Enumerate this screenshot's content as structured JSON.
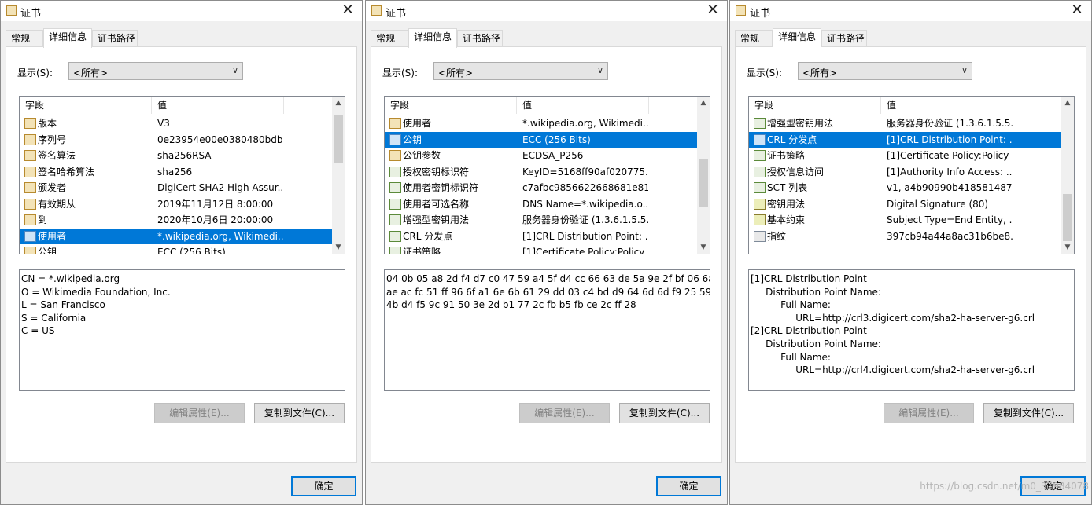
{
  "watermark": "https://blog.csdn.net/m0_37984078",
  "dialogs": [
    {
      "title": "证书",
      "close": "✕",
      "tabs": [
        "常规",
        "详细信息",
        "证书路径"
      ],
      "active_tab": 1,
      "show_label": "显示(S):",
      "show_value": "<所有>",
      "columns": [
        "字段",
        "值"
      ],
      "rows": [
        {
          "icon": "cert-field-icon",
          "field": "版本",
          "value": "V3",
          "selected": false
        },
        {
          "icon": "cert-field-icon",
          "field": "序列号",
          "value": "0e23954e00e0380480bdb...",
          "selected": false
        },
        {
          "icon": "cert-field-icon",
          "field": "签名算法",
          "value": "sha256RSA",
          "selected": false
        },
        {
          "icon": "cert-field-icon",
          "field": "签名哈希算法",
          "value": "sha256",
          "selected": false
        },
        {
          "icon": "cert-field-icon",
          "field": "颁发者",
          "value": "DigiCert SHA2 High Assur...",
          "selected": false
        },
        {
          "icon": "cert-field-icon",
          "field": "有效期从",
          "value": "2019年11月12日 8:00:00",
          "selected": false
        },
        {
          "icon": "cert-field-icon",
          "field": "到",
          "value": "2020年10月6日 20:00:00",
          "selected": false
        },
        {
          "icon": "cert-field-icon",
          "field": "使用者",
          "value": "*.wikipedia.org, Wikimedi...",
          "selected": true
        },
        {
          "icon": "cert-field-icon",
          "field": "公钥",
          "value": "ECC (256 Bits)",
          "selected": false
        }
      ],
      "scroll_thumb_fraction_top": 0.05,
      "scroll_thumb_fraction_size": 0.36,
      "details": [
        "CN = *.wikipedia.org",
        "O = Wikimedia Foundation, Inc.",
        "L = San Francisco",
        "S = California",
        "C = US"
      ],
      "edit_button": "编辑属性(E)...",
      "copy_button": "复制到文件(C)...",
      "ok_button": "确定"
    },
    {
      "title": "证书",
      "close": "✕",
      "tabs": [
        "常规",
        "详细信息",
        "证书路径"
      ],
      "active_tab": 1,
      "show_label": "显示(S):",
      "show_value": "<所有>",
      "columns": [
        "字段",
        "值"
      ],
      "rows": [
        {
          "icon": "cert-field-icon",
          "field": "使用者",
          "value": "*.wikipedia.org, Wikimedi...",
          "selected": false
        },
        {
          "icon": "cert-field-icon",
          "field": "公钥",
          "value": "ECC (256 Bits)",
          "selected": true
        },
        {
          "icon": "cert-field-icon",
          "field": "公钥参数",
          "value": "ECDSA_P256",
          "selected": false
        },
        {
          "icon": "extension-icon",
          "field": "授权密钥标识符",
          "value": "KeyID=5168ff90af020775...",
          "selected": false
        },
        {
          "icon": "extension-icon",
          "field": "使用者密钥标识符",
          "value": "c7afbc9856622668681e81...",
          "selected": false
        },
        {
          "icon": "extension-icon",
          "field": "使用者可选名称",
          "value": "DNS Name=*.wikipedia.o...",
          "selected": false
        },
        {
          "icon": "extension-icon",
          "field": "增强型密钥用法",
          "value": "服务器身份验证 (1.3.6.1.5.5...",
          "selected": false
        },
        {
          "icon": "extension-icon",
          "field": "CRL 分发点",
          "value": "[1]CRL Distribution Point: ...",
          "selected": false
        },
        {
          "icon": "extension-icon",
          "field": "证书策略",
          "value": "[1]Certificate Policy:Policy ...",
          "selected": false
        }
      ],
      "scroll_thumb_fraction_top": 0.38,
      "scroll_thumb_fraction_size": 0.36,
      "details": [
        "04 0b 05 a8 2d f4 d7 c0 47 59 a4 5f d4 cc 66 63 de 5a 9e 2f bf 06 6a c6",
        "ae ac fc 51 ff 96 6f a1 6e 6b 61 29 dd 03 c4 bd d9 64 6d 6d f9 25 59",
        "4b d4 f5 9c 91 50 3e 2d b1 77 2c fb b5 fb ce 2c ff 28"
      ],
      "edit_button": "编辑属性(E)...",
      "copy_button": "复制到文件(C)...",
      "ok_button": "确定"
    },
    {
      "title": "证书",
      "close": "✕",
      "tabs": [
        "常规",
        "详细信息",
        "证书路径"
      ],
      "active_tab": 1,
      "show_label": "显示(S):",
      "show_value": "<所有>",
      "columns": [
        "字段",
        "值"
      ],
      "rows": [
        {
          "icon": "extension-icon",
          "field": "增强型密钥用法",
          "value": "服务器身份验证 (1.3.6.1.5.5...",
          "selected": false
        },
        {
          "icon": "extension-icon",
          "field": "CRL 分发点",
          "value": "[1]CRL Distribution Point: ...",
          "selected": true
        },
        {
          "icon": "extension-icon",
          "field": "证书策略",
          "value": "[1]Certificate Policy:Policy ...",
          "selected": false
        },
        {
          "icon": "extension-icon",
          "field": "授权信息访问",
          "value": "[1]Authority Info Access: ...",
          "selected": false
        },
        {
          "icon": "extension-icon",
          "field": "SCT 列表",
          "value": "v1, a4b90990b418581487...",
          "selected": false
        },
        {
          "icon": "key-icon",
          "field": "密钥用法",
          "value": "Digital Signature (80)",
          "selected": false
        },
        {
          "icon": "key-icon",
          "field": "基本约束",
          "value": "Subject Type=End Entity, ...",
          "selected": false
        },
        {
          "icon": "fingerprint-icon",
          "field": "指纹",
          "value": "397cb94a44a8ac31b6be8...",
          "selected": false
        }
      ],
      "scroll_thumb_fraction_top": 0.64,
      "scroll_thumb_fraction_size": 0.36,
      "details": [
        "[1]CRL Distribution Point",
        "     Distribution Point Name:",
        "          Full Name:",
        "               URL=http://crl3.digicert.com/sha2-ha-server-g6.crl",
        "[2]CRL Distribution Point",
        "     Distribution Point Name:",
        "          Full Name:",
        "               URL=http://crl4.digicert.com/sha2-ha-server-g6.crl"
      ],
      "edit_button": "编辑属性(E)...",
      "copy_button": "复制到文件(C)...",
      "ok_button": "确定"
    }
  ]
}
